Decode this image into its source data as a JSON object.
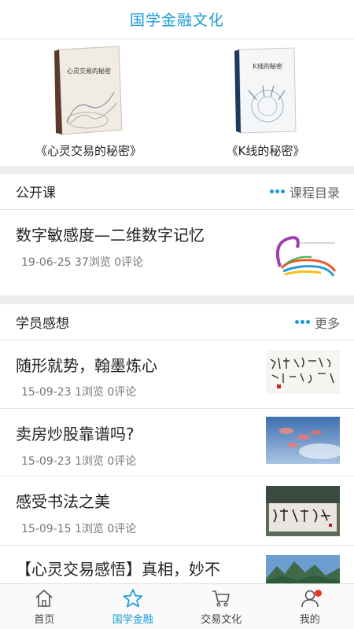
{
  "header": {
    "title": "国学金融文化"
  },
  "books": [
    {
      "title": "《心灵交易的秘密》"
    },
    {
      "title": "《K线的秘密》"
    }
  ],
  "open_course": {
    "title": "公开课",
    "more_label": "课程目录",
    "items": [
      {
        "title": "数字敏感度—二维数字记忆",
        "meta": "19-06-25 37浏览 0评论"
      }
    ]
  },
  "student_thoughts": {
    "title": "学员感想",
    "more_label": "更多",
    "items": [
      {
        "title": "随形就势，翰墨炼心",
        "meta": "15-09-23 1浏览 0评论"
      },
      {
        "title": "卖房炒股靠谱吗?",
        "meta": "15-09-23 1浏览 0评论"
      },
      {
        "title": "感受书法之美",
        "meta": "15-09-15 1浏览 0评论"
      },
      {
        "title": "【心灵交易感悟】真相，妙不"
      }
    ]
  },
  "tabbar": {
    "items": [
      {
        "label": "首页",
        "icon": "home-icon"
      },
      {
        "label": "国学金融",
        "icon": "star-icon",
        "active": true
      },
      {
        "label": "交易文化",
        "icon": "cart-icon"
      },
      {
        "label": "我的",
        "icon": "user-icon",
        "badge": true
      }
    ]
  },
  "colors": {
    "accent": "#1a9bd7",
    "badge": "#e8382c",
    "divider": "#eeeeee"
  }
}
